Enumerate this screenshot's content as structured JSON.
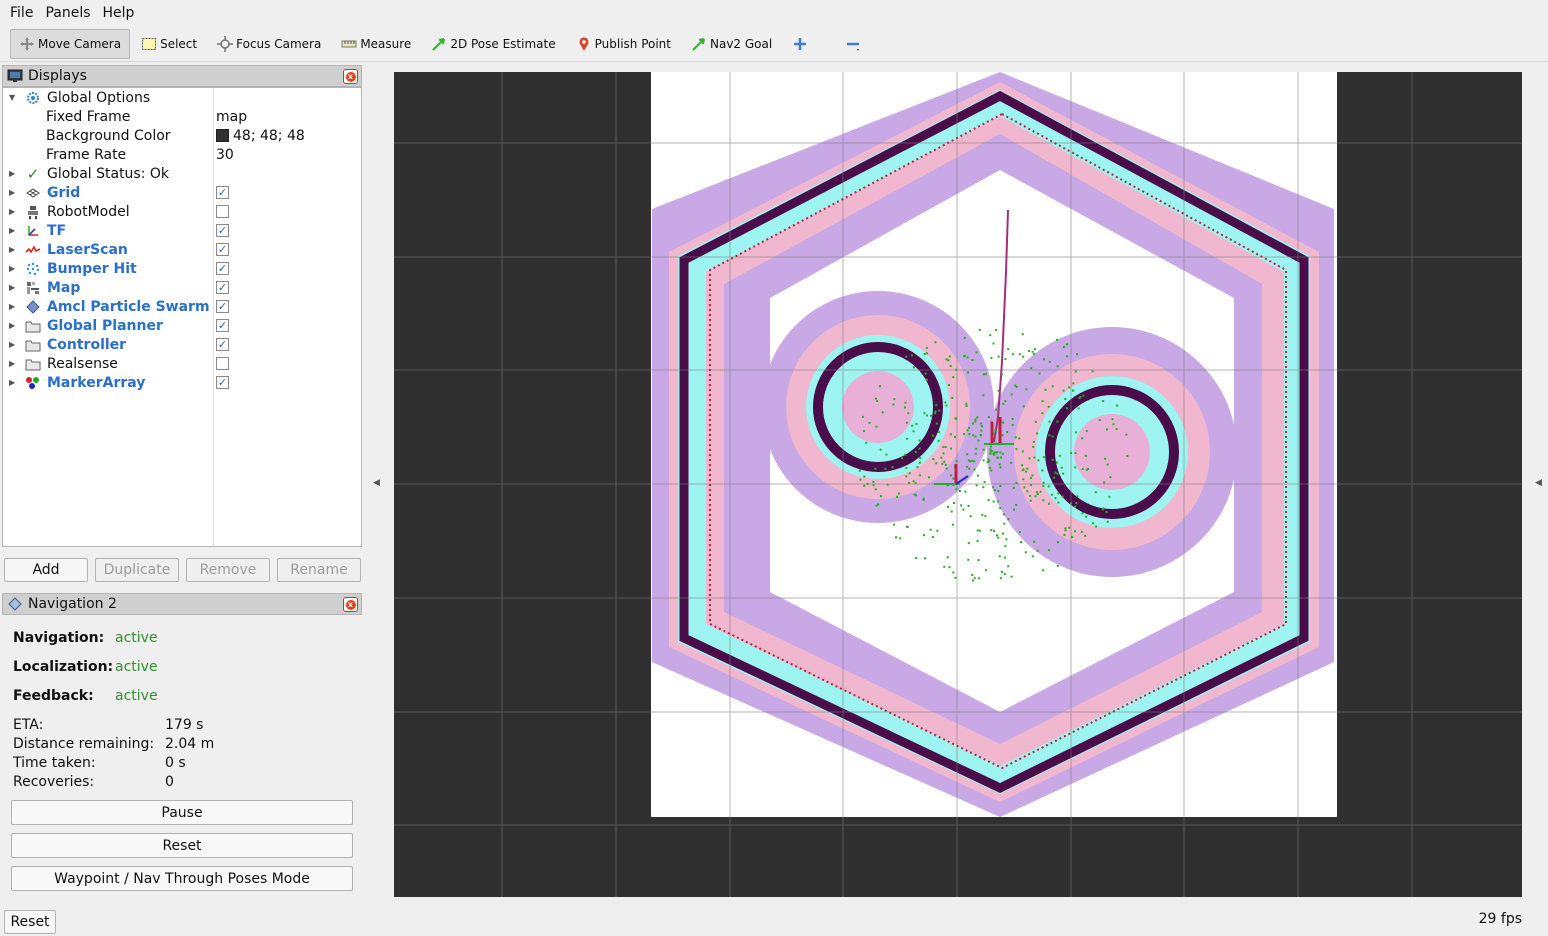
{
  "menu": {
    "file": "File",
    "panels": "Panels",
    "help": "Help"
  },
  "toolbar": {
    "move_camera": "Move Camera",
    "select": "Select",
    "focus_camera": "Focus Camera",
    "measure": "Measure",
    "pose_estimate": "2D Pose Estimate",
    "publish_point": "Publish Point",
    "nav2_goal": "Nav2 Goal"
  },
  "displays": {
    "title": "Displays",
    "global_options": "Global Options",
    "fixed_frame_label": "Fixed Frame",
    "fixed_frame_value": "map",
    "bg_color_label": "Background Color",
    "bg_color_value": "48; 48; 48",
    "frame_rate_label": "Frame Rate",
    "frame_rate_value": "30",
    "global_status": "Global Status: Ok",
    "items": [
      {
        "label": "Grid",
        "checked": true
      },
      {
        "label": "RobotModel",
        "checked": false
      },
      {
        "label": "TF",
        "checked": true
      },
      {
        "label": "LaserScan",
        "checked": true
      },
      {
        "label": "Bumper Hit",
        "checked": true
      },
      {
        "label": "Map",
        "checked": true
      },
      {
        "label": "Amcl Particle Swarm",
        "checked": true
      },
      {
        "label": "Global Planner",
        "checked": true
      },
      {
        "label": "Controller",
        "checked": true
      },
      {
        "label": "Realsense",
        "checked": false
      },
      {
        "label": "MarkerArray",
        "checked": true
      }
    ],
    "buttons": {
      "add": "Add",
      "duplicate": "Duplicate",
      "remove": "Remove",
      "rename": "Rename"
    }
  },
  "navigation": {
    "title": "Navigation 2",
    "nav_label": "Navigation:",
    "nav_value": "active",
    "loc_label": "Localization:",
    "loc_value": "active",
    "fb_label": "Feedback:",
    "fb_value": "active",
    "eta_label": "ETA:",
    "eta_value": "179 s",
    "dist_label": "Distance remaining:",
    "dist_value": "2.04 m",
    "time_label": "Time taken:",
    "time_value": "0 s",
    "rec_label": "Recoveries:",
    "rec_value": "0",
    "pause": "Pause",
    "reset": "Reset",
    "waypoint": "Waypoint / Nav Through Poses Mode"
  },
  "status": {
    "reset": "Reset",
    "fps": "29 fps"
  },
  "colors": {
    "background": "#303030",
    "costmap_outer": "#c8a7e6",
    "costmap_inner": "#f3b5cc",
    "inflation_cyan": "#9ef4f0",
    "obstacle": "#4a0d4a",
    "particle": "#22b022",
    "path": "#c41e3a",
    "link_blue": "#2a6fc9",
    "active_green": "#2f8f2f"
  }
}
